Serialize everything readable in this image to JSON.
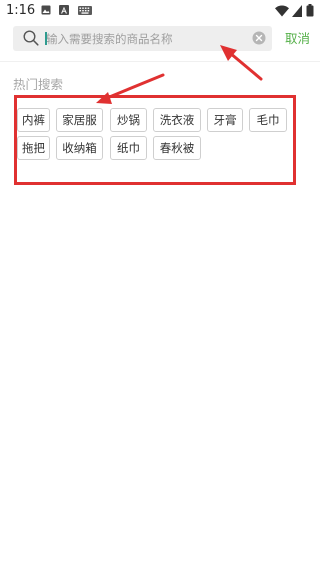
{
  "status_bar": {
    "time": "1:16",
    "icons": [
      "image-icon",
      "a-icon",
      "keyboard-icon",
      "wifi-icon",
      "signal-icon",
      "battery-icon"
    ]
  },
  "search": {
    "placeholder": "输入需要搜索的商品名称",
    "value": "",
    "cancel_label": "取消"
  },
  "hot_search": {
    "title": "热门搜索",
    "tags": [
      "内裤",
      "家居服",
      "炒锅",
      "洗衣液",
      "牙膏",
      "毛巾",
      "拖把",
      "收纳箱",
      "纸巾",
      "春秋被"
    ]
  },
  "colors": {
    "accent": "#56b04a",
    "annotation": "#e03131",
    "search_bg": "#eeeeee"
  }
}
